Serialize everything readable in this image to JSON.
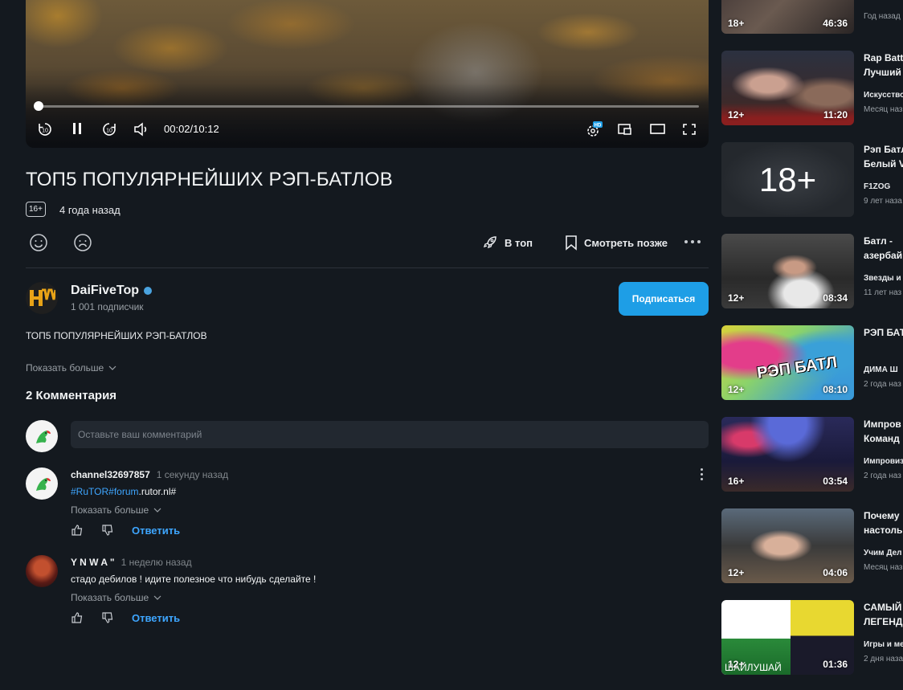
{
  "player": {
    "current_time": "00:02",
    "duration": "10:12",
    "time_sep": "/",
    "progress": 0.003,
    "quality_badge": "HD"
  },
  "video": {
    "title": "ТОП5 ПОПУЛЯРНЕЙШИХ РЭП-БАТЛОВ",
    "age_rating": "16+",
    "posted": "4 года назад",
    "to_top_label": "В топ",
    "watch_later_label": "Смотреть позже",
    "description": "ТОП5 ПОПУЛЯРНЕЙШИХ РЭП-БАТЛОВ",
    "show_more": "Показать больше"
  },
  "channel": {
    "name": "DaiFiveTop",
    "subscribers": "1 001 подписчик",
    "subscribe_label": "Подписаться",
    "avatar_text": "HW"
  },
  "comments": {
    "count_label": "2 Комментария",
    "input_placeholder": "Оставьте ваш комментарий",
    "items": [
      {
        "author": "channel32697857",
        "time": "1 секунду назад",
        "text_tag1": "#RuTOR",
        "text_tag2": "#forum",
        "text_rest": ".rutor.nl#",
        "show_more": "Показать больше",
        "reply": "Ответить"
      },
      {
        "author": "Y N W A \"",
        "time": "1 неделю назад",
        "text": "стадо дебилов  ! идите полезное что нибудь сделайте !",
        "show_more": "Показать больше",
        "reply": "Ответить"
      }
    ]
  },
  "sidebar": [
    {
      "badge": "18+",
      "duration": "46:36",
      "title": "",
      "channel": "",
      "meta": "Год назад"
    },
    {
      "badge": "12+",
      "duration": "11:20",
      "title": "Rap Batt",
      "title2": "Лучший",
      "channel": "Искусство",
      "meta": "Месяц наз"
    },
    {
      "badge": "",
      "duration": "",
      "big": "18+",
      "title": "Рэп Батл",
      "title2": "Белый V",
      "channel": "F1ZOG",
      "meta": "9 лет наза"
    },
    {
      "badge": "12+",
      "duration": "08:34",
      "title": "Батл -",
      "title2": "азербай",
      "channel": "Звезды и",
      "meta": "11 лет наз"
    },
    {
      "badge": "12+",
      "duration": "08:10",
      "title": "РЭП БАТ",
      "title2": "",
      "channel": "ДИМА Ш",
      "meta": "2 года наз",
      "overlay": "РЭП БАТЛ"
    },
    {
      "badge": "16+",
      "duration": "03:54",
      "title": "Импров",
      "title2": "Команд",
      "channel": "Импровиз",
      "meta": "2 года наз"
    },
    {
      "badge": "12+",
      "duration": "04:06",
      "title": "Почему",
      "title2": "настоль",
      "channel": "Учим Дел",
      "meta": "Месяц наз"
    },
    {
      "badge": "12+",
      "duration": "01:36",
      "title": "САМЫЙ",
      "title2": "ЛЕГЕНДА",
      "channel": "Игры и ме",
      "meta": "2 дня наза",
      "overlay": "ШАЙЛУШАЙ"
    }
  ],
  "colors": {
    "background": "#14191f",
    "accent": "#1e9ee6",
    "link": "#3ea6ff"
  }
}
